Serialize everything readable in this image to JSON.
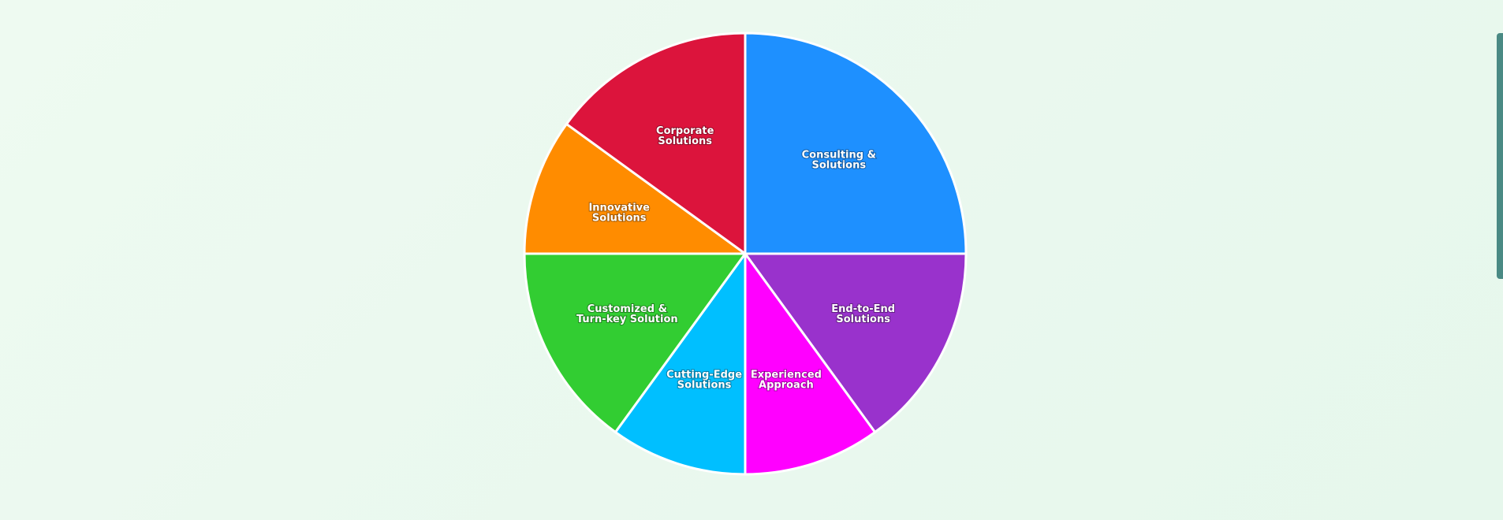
{
  "chart_data": {
    "type": "pie",
    "title": "",
    "categories": [
      "Consulting & Solutions",
      "End-to-End Solutions",
      "Experienced Approach",
      "Cutting-Edge Solutions",
      "Customized & Turn-key Solution",
      "Innovative Solutions",
      "Corporate Solutions"
    ],
    "label_lines": [
      [
        "Consulting &",
        "Solutions"
      ],
      [
        "End-to-End",
        "Solutions"
      ],
      [
        "Experienced",
        "Approach"
      ],
      [
        "Cutting-Edge",
        "Solutions"
      ],
      [
        "Customized &",
        "Turn-key Solution"
      ],
      [
        "Innovative",
        "Solutions"
      ],
      [
        "Corporate",
        "Solutions"
      ]
    ],
    "values": [
      25,
      15,
      10,
      10,
      15,
      10,
      15
    ],
    "colors": [
      "#1e90ff",
      "#9932cc",
      "#ff00ff",
      "#00bfff",
      "#32cd32",
      "#ff8c00",
      "#dc143c"
    ],
    "start_angle_deg": 0,
    "direction": "clockwise-from-top",
    "legend": "none"
  }
}
